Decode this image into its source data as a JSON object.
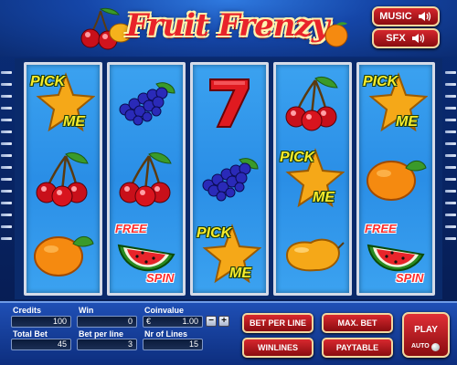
{
  "header": {
    "title": "Fruit Frenzy",
    "music_label": "MUSIC",
    "sfx_label": "SFX",
    "speaker_icon": "speaker-icon"
  },
  "reels": [
    [
      "pick-me-star",
      "cherries",
      "orange"
    ],
    [
      "grapes",
      "cherries",
      "free-spin-watermelon"
    ],
    [
      "seven",
      "grapes",
      "pick-me-star"
    ],
    [
      "cherries",
      "pick-me-star",
      "pear"
    ],
    [
      "pick-me-star",
      "orange",
      "free-spin-watermelon"
    ]
  ],
  "symbol_text": {
    "pick": "PICK",
    "me": "ME",
    "free": "FREE",
    "spin": "SPIN"
  },
  "panel": {
    "credits_label": "Credits",
    "credits_value": "100",
    "win_label": "Win",
    "win_value": "0",
    "coinvalue_label": "Coinvalue",
    "coinvalue_currency": "€",
    "coinvalue_value": "1.00",
    "total_bet_label": "Total Bet",
    "total_bet_value": "45",
    "bet_per_line_label": "Bet per line",
    "bet_per_line_value": "3",
    "nr_of_lines_label": "Nr of Lines",
    "nr_of_lines_value": "15",
    "minus": "−",
    "plus": "+",
    "bet_per_line_button": "BET PER LINE",
    "max_bet_button": "MAX. BET",
    "winlines_button": "WINLINES",
    "paytable_button": "PAYTABLE",
    "play_button": "PLAY",
    "auto_label": "AUTO"
  },
  "colors": {
    "button_red": "#d8282e",
    "reel_blue": "#2a8ee6",
    "panel_blue": "#1f4fb5",
    "label_yellow": "#f7ec2a"
  }
}
